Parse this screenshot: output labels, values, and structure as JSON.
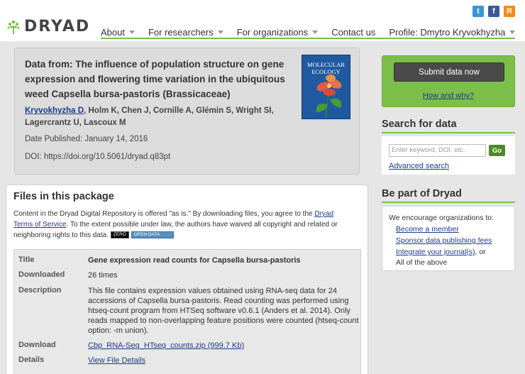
{
  "social": {
    "twitter": "t",
    "facebook": "f",
    "rss": "R"
  },
  "logo": {
    "text": "DRYAD"
  },
  "nav": [
    {
      "label": "About",
      "dropdown": true
    },
    {
      "label": "For researchers",
      "dropdown": true
    },
    {
      "label": "For organizations",
      "dropdown": true
    },
    {
      "label": "Contact us",
      "dropdown": false
    },
    {
      "label": "Profile: Dmytro Kryvokhyzha",
      "dropdown": true
    }
  ],
  "article": {
    "title": "Data from: The influence of population structure on gene expression and flowering time variation in the ubiquitous weed Capsella bursa-pastoris (Brassicaceae)",
    "author_link": "Kryvokhyzha D",
    "authors_rest": ", Holm K, Chen J, Cornille A, Glémin S, Wright SI, Lagercrantz U, Lascoux M",
    "date_published": "Date Published: January 14, 2016",
    "doi": "DOI: https://doi.org/10.5061/dryad.q83pt",
    "cover_title": "MOLECULAR ECOLOGY"
  },
  "files": {
    "heading": "Files in this package",
    "notice_pre": "Content in the Dryad Digital Repository is offered \"as is.\" By downloading files, you agree to the ",
    "notice_link": "Dryad Terms of Service",
    "notice_post": ". To the extent possible under law, the authors have waived all copyright and related or neighboring rights to this data.",
    "badge_zero": "ZERO",
    "badge_opendata": "OPEN DATA",
    "rows": {
      "title_k": "Title",
      "title_v": "Gene expression read counts for Capsella bursa-pastoris",
      "downloaded_k": "Downloaded",
      "downloaded_v": "26 times",
      "description_k": "Description",
      "description_v": "This file contains expression values obtained using RNA-seq data for 24 accessions of Capsella bursa-pastoris. Read counting was performed using htseq-count program from HTSeq software v0.6.1 (Anders et al. 2014). Only reads mapped to non-overlapping feature positions were counted (htseq-count option: -m union).",
      "download_k": "Download",
      "download_v": "Cbp_RNA-Seq_HTseq_counts.zip (999.7 Kb)",
      "details_k": "Details",
      "details_v": "View File Details"
    }
  },
  "sidebar": {
    "submit_label": "Submit data now",
    "how_why": "How and why?",
    "search_heading": "Search for data",
    "search_placeholder": "Enter keyword, DOI, etc.",
    "go_label": "Go",
    "advanced_search": "Advanced search",
    "part_heading": "Be part of Dryad",
    "part_intro": "We encourage organizations to:",
    "part_items": [
      "Become a member",
      "Sponsor data publishing fees",
      "Integrate your journal(s)",
      "All of the above"
    ],
    "part_or": ", or"
  },
  "colors": {
    "accent_green": "#7bbf4a",
    "link_blue": "#1a3a8c",
    "button_dark": "#4a4a4a"
  }
}
